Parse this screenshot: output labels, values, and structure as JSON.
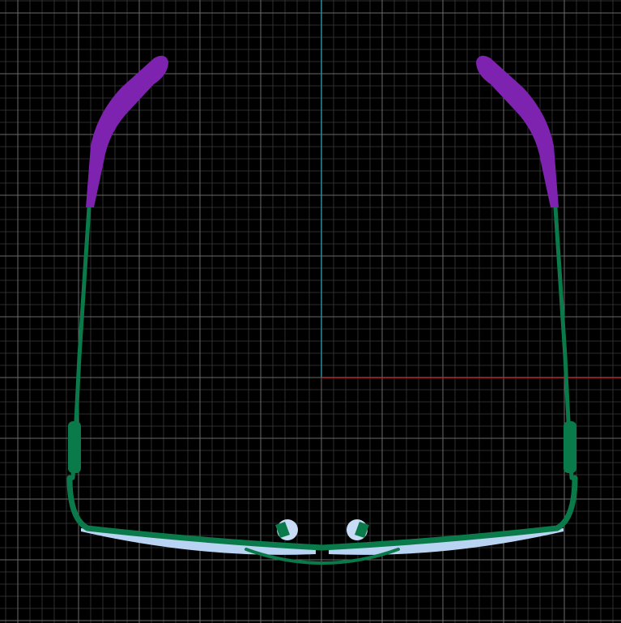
{
  "viewport": {
    "view": "top",
    "background_color": "#000000",
    "grid": {
      "visible": true,
      "minor_color": "#3a3a3a",
      "major_color": "#6a6a6a"
    },
    "axes": {
      "x_axis_color": "#c0282a",
      "y_axis_color": "#2a8a9a"
    }
  },
  "model": {
    "name": "eyeglasses-frame",
    "parts": [
      {
        "name": "temple-tip-left",
        "color": "#7e22b0"
      },
      {
        "name": "temple-tip-right",
        "color": "#7e22b0"
      },
      {
        "name": "temple-arm-left",
        "color": "#0b7a4a"
      },
      {
        "name": "temple-arm-right",
        "color": "#0b7a4a"
      },
      {
        "name": "front-frame",
        "color": "#0b7a4a"
      },
      {
        "name": "bridge",
        "color": "#0b7a4a"
      },
      {
        "name": "lens-left",
        "color": "#b9d3f3"
      },
      {
        "name": "lens-right",
        "color": "#b9d3f3"
      },
      {
        "name": "nose-pad-left",
        "color": "#c9dcf6"
      },
      {
        "name": "nose-pad-right",
        "color": "#c9dcf6"
      }
    ]
  }
}
